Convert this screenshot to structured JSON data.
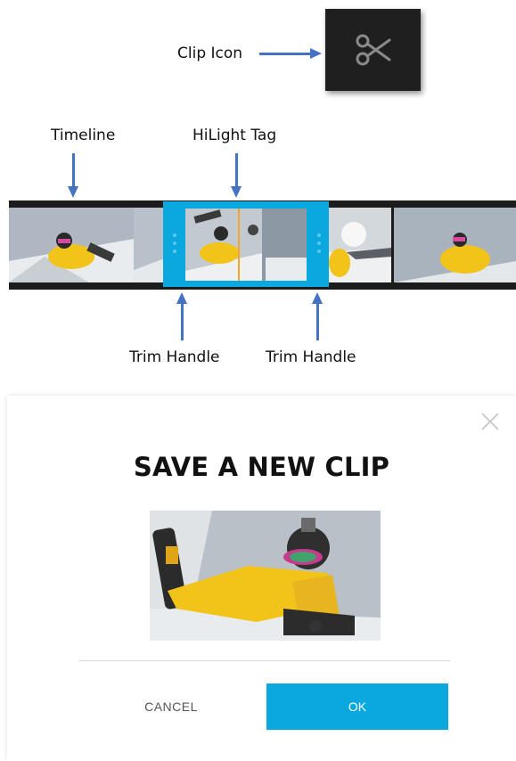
{
  "annotations": {
    "clip_icon": "Clip Icon",
    "timeline": "Timeline",
    "hilight_tag": "HiLight Tag",
    "trim_handle_left": "Trim Handle",
    "trim_handle_right": "Trim Handle"
  },
  "clip_icon": {
    "icon": "scissors-icon"
  },
  "dialog": {
    "title": "SAVE A NEW CLIP",
    "cancel_label": "CANCEL",
    "ok_label": "OK",
    "close_icon": "close-icon"
  },
  "colors": {
    "accent": "#0aa8df",
    "annotation_arrow": "#4472c4",
    "hilight_tag": "#f5a623",
    "timeline_bg": "#1c1c1c"
  }
}
